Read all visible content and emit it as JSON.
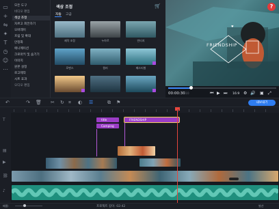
{
  "colors": {
    "accent": "#3f8cff",
    "effect_badge": "#a94be0",
    "title_clip": "#9b3dc6",
    "playhead": "#e8463d",
    "help": "#e23b3b",
    "export": "#2f7df0"
  },
  "rail_icons": [
    "file-icon",
    "plus-icon",
    "transition-icon",
    "magic-icon",
    "text-icon",
    "clock-icon",
    "sticker-icon",
    "more-icon"
  ],
  "tools": {
    "heading": "모든 도구",
    "items": [
      {
        "label": "비디오 편집",
        "grp": true
      },
      {
        "label": "색상 조정",
        "sel": true
      },
      {
        "label": "자르고 회전하기"
      },
      {
        "label": "오버레이"
      },
      {
        "label": "흐림 및 확대"
      },
      {
        "label": "안정화"
      },
      {
        "label": "애니메이션"
      },
      {
        "label": "크로마키 및 숨기기"
      },
      {
        "label": "이미지"
      },
      {
        "label": "원본 설정"
      },
      {
        "label": "로고제작"
      },
      {
        "label": "시트 효과"
      },
      {
        "label": "오디오 편집",
        "grp": true
      }
    ]
  },
  "panel": {
    "title": "색상 조정",
    "tabs": [
      "자동",
      "고급"
    ],
    "presets": [
      {
        "label": "제작 조정",
        "bg": "linear-gradient(180deg,#98b9c8,#4d6f7f)"
      },
      {
        "label": "누아르",
        "bg": "linear-gradient(180deg,#9aa3a7,#3d4347)"
      },
      {
        "label": "빈티지",
        "bg": "linear-gradient(180deg,#7aa6b0,#2f5862)"
      },
      {
        "label": "로맨스",
        "bg": "linear-gradient(180deg,#5fa3c9,#224a63)"
      },
      {
        "label": "컬러",
        "bg": "linear-gradient(180deg,#7fb2c4,#2f5b6c)"
      },
      {
        "label": "페스티벌",
        "bg": "linear-gradient(180deg,#8fc7d7,#2b6e7d)"
      },
      {
        "label": "",
        "bg": "linear-gradient(180deg,#f3c98a,#6a4b30)"
      },
      {
        "label": "",
        "bg": "linear-gradient(180deg,#4f6f82,#1e3441)"
      },
      {
        "label": "",
        "bg": "linear-gradient(180deg,#6aa6c1,#1d4a5c)"
      }
    ]
  },
  "preview": {
    "overlay_text": "FRIENDSHIP",
    "progress": 0.21,
    "time_current": "00:00:30",
    "time_frames": "210",
    "ratio": "16:9"
  },
  "timeline": {
    "ruler_labels": [
      "00:00:00"
    ],
    "title_clips": [
      "title",
      "Camping",
      "FRIENDSHIP"
    ]
  },
  "toolbar": {
    "export_label": "내보내기"
  },
  "status": {
    "text": "프로젝트 길이: 02:42",
    "right": "발산",
    "zoom_label": "배율:"
  }
}
